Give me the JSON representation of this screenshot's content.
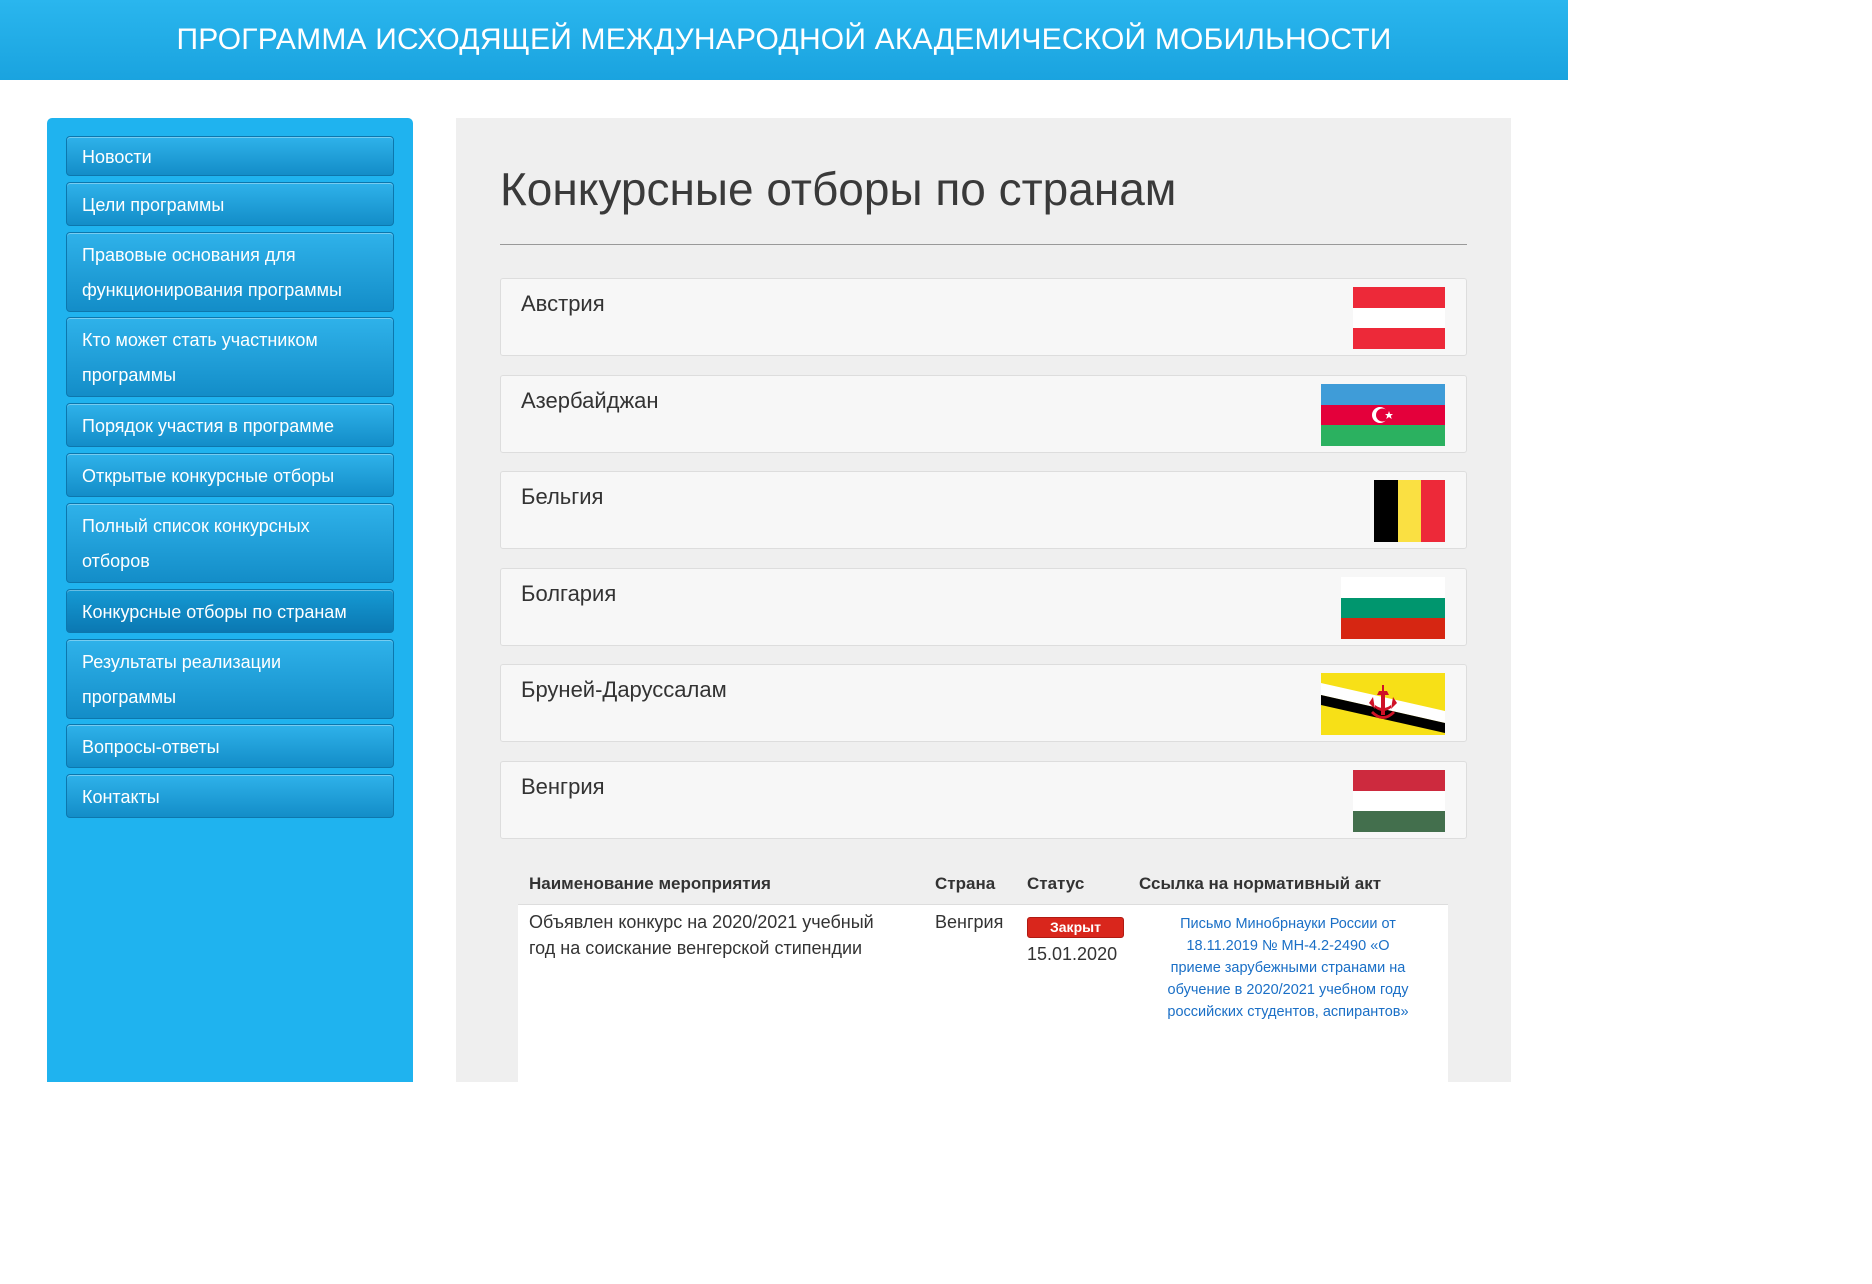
{
  "header": {
    "title": "ПРОГРАММА ИСХОДЯЩЕЙ МЕЖДУНАРОДНОЙ АКАДЕМИЧЕСКОЙ МОБИЛЬНОСТИ"
  },
  "sidebar": {
    "items": [
      {
        "line1": "Новости",
        "line2": ""
      },
      {
        "line1": "Цели программы",
        "line2": ""
      },
      {
        "line1": "Правовые основания для",
        "line2": "функционирования программы"
      },
      {
        "line1": "Кто может стать участником",
        "line2": "программы"
      },
      {
        "line1": "Порядок участия в программе",
        "line2": ""
      },
      {
        "line1": "Открытые конкурсные отборы",
        "line2": ""
      },
      {
        "line1": "Полный список конкурсных",
        "line2": "отборов"
      },
      {
        "line1": "Конкурсные отборы по странам",
        "line2": ""
      },
      {
        "line1": "Результаты реализации",
        "line2": "программы"
      },
      {
        "line1": "Вопросы-ответы",
        "line2": ""
      },
      {
        "line1": "Контакты",
        "line2": ""
      }
    ]
  },
  "main": {
    "title": "Конкурсные отборы по странам",
    "countries": [
      {
        "name": "Австрия",
        "flag": "austria-flag-icon"
      },
      {
        "name": "Азербайджан",
        "flag": "azerbaijan-flag-icon"
      },
      {
        "name": "Бельгия",
        "flag": "belgium-flag-icon"
      },
      {
        "name": "Болгария",
        "flag": "bulgaria-flag-icon"
      },
      {
        "name": "Бруней-Даруссалам",
        "flag": "brunei-flag-icon"
      },
      {
        "name": "Венгрия",
        "flag": "hungary-flag-icon"
      }
    ],
    "table": {
      "headers": {
        "event": "Наименование мероприятия",
        "country": "Страна",
        "status": "Статус",
        "link": "Ссылка на нормативный акт"
      },
      "rows": [
        {
          "event_line1": "Объявлен конкурс на 2020/2021 учебный",
          "event_line2": "год на соискание венгерской стипендии",
          "country": "Венгрия",
          "status": "Закрыт",
          "date": "15.01.2020",
          "link_lines": [
            "Письмо Минобрнауки России от",
            "18.11.2019 № МН-4.2-2490 «О",
            "приеме зарубежными странами на",
            "обучение в 2020/2021 учебном году",
            "российских студентов, аспирантов»"
          ]
        }
      ]
    }
  },
  "colors": {
    "header_bg": "#1aa3df",
    "sidebar_bg": "#1fb3ef",
    "badge_closed": "#d9261c",
    "link": "#1a6fc6"
  }
}
